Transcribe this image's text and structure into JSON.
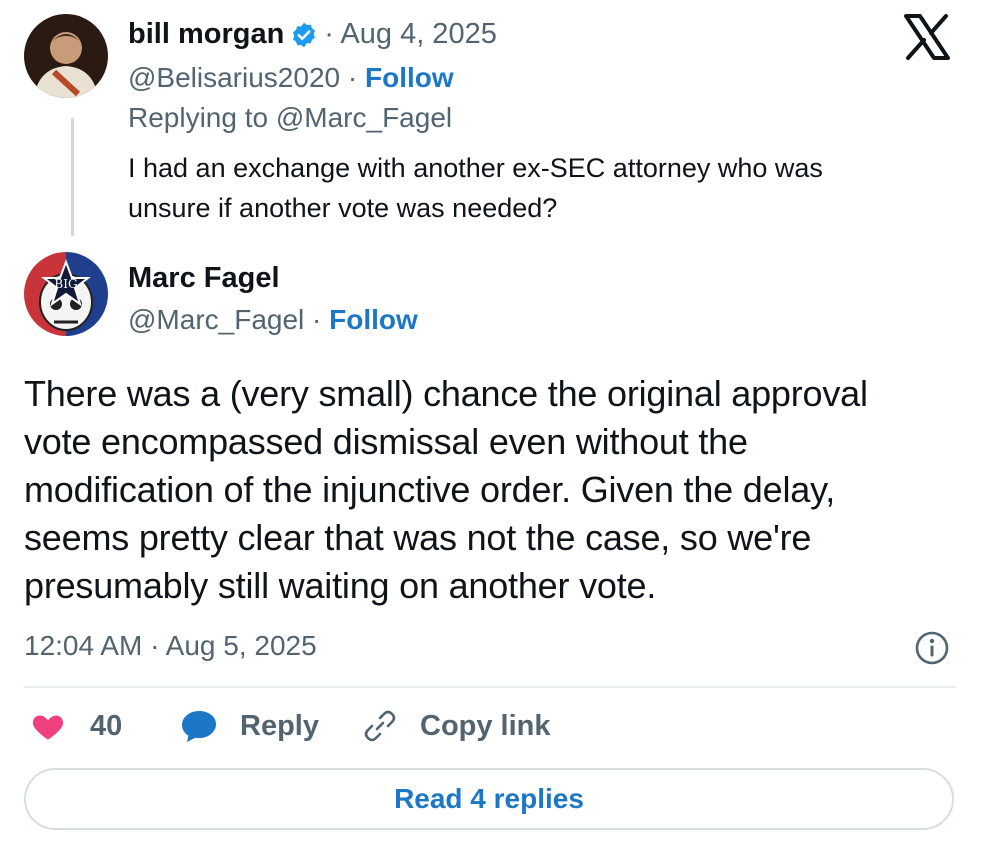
{
  "reply_tweet": {
    "author_name": "bill morgan",
    "handle": "@Belisarius2020",
    "date": "· Aug 4, 2025",
    "follow_label": "Follow",
    "replying_to": "Replying to @Marc_Fagel",
    "text_line1": "I had an exchange with another ex-SEC attorney who was",
    "text_line2": "unsure if another vote was needed?"
  },
  "main_tweet": {
    "author_name": "Marc Fagel",
    "handle": "@Marc_Fagel",
    "follow_label": "Follow",
    "avatar_text": "BIG",
    "text_lines": [
      "There was a (very small) chance the original approval",
      "vote encompassed dismissal even without the",
      "modification of the injunctive order. Given the delay,",
      "seems pretty clear that was not the case, so we're",
      "presumably still waiting on another vote."
    ],
    "timestamp": "12:04 AM · Aug 5, 2025"
  },
  "actions": {
    "like_count": "40",
    "reply_label": "Reply",
    "copy_label": "Copy link"
  },
  "read_replies_label": "Read 4 replies",
  "colors": {
    "accent": "#1d77c7",
    "like": "#f0417e",
    "verified": "#1d9bf0"
  }
}
